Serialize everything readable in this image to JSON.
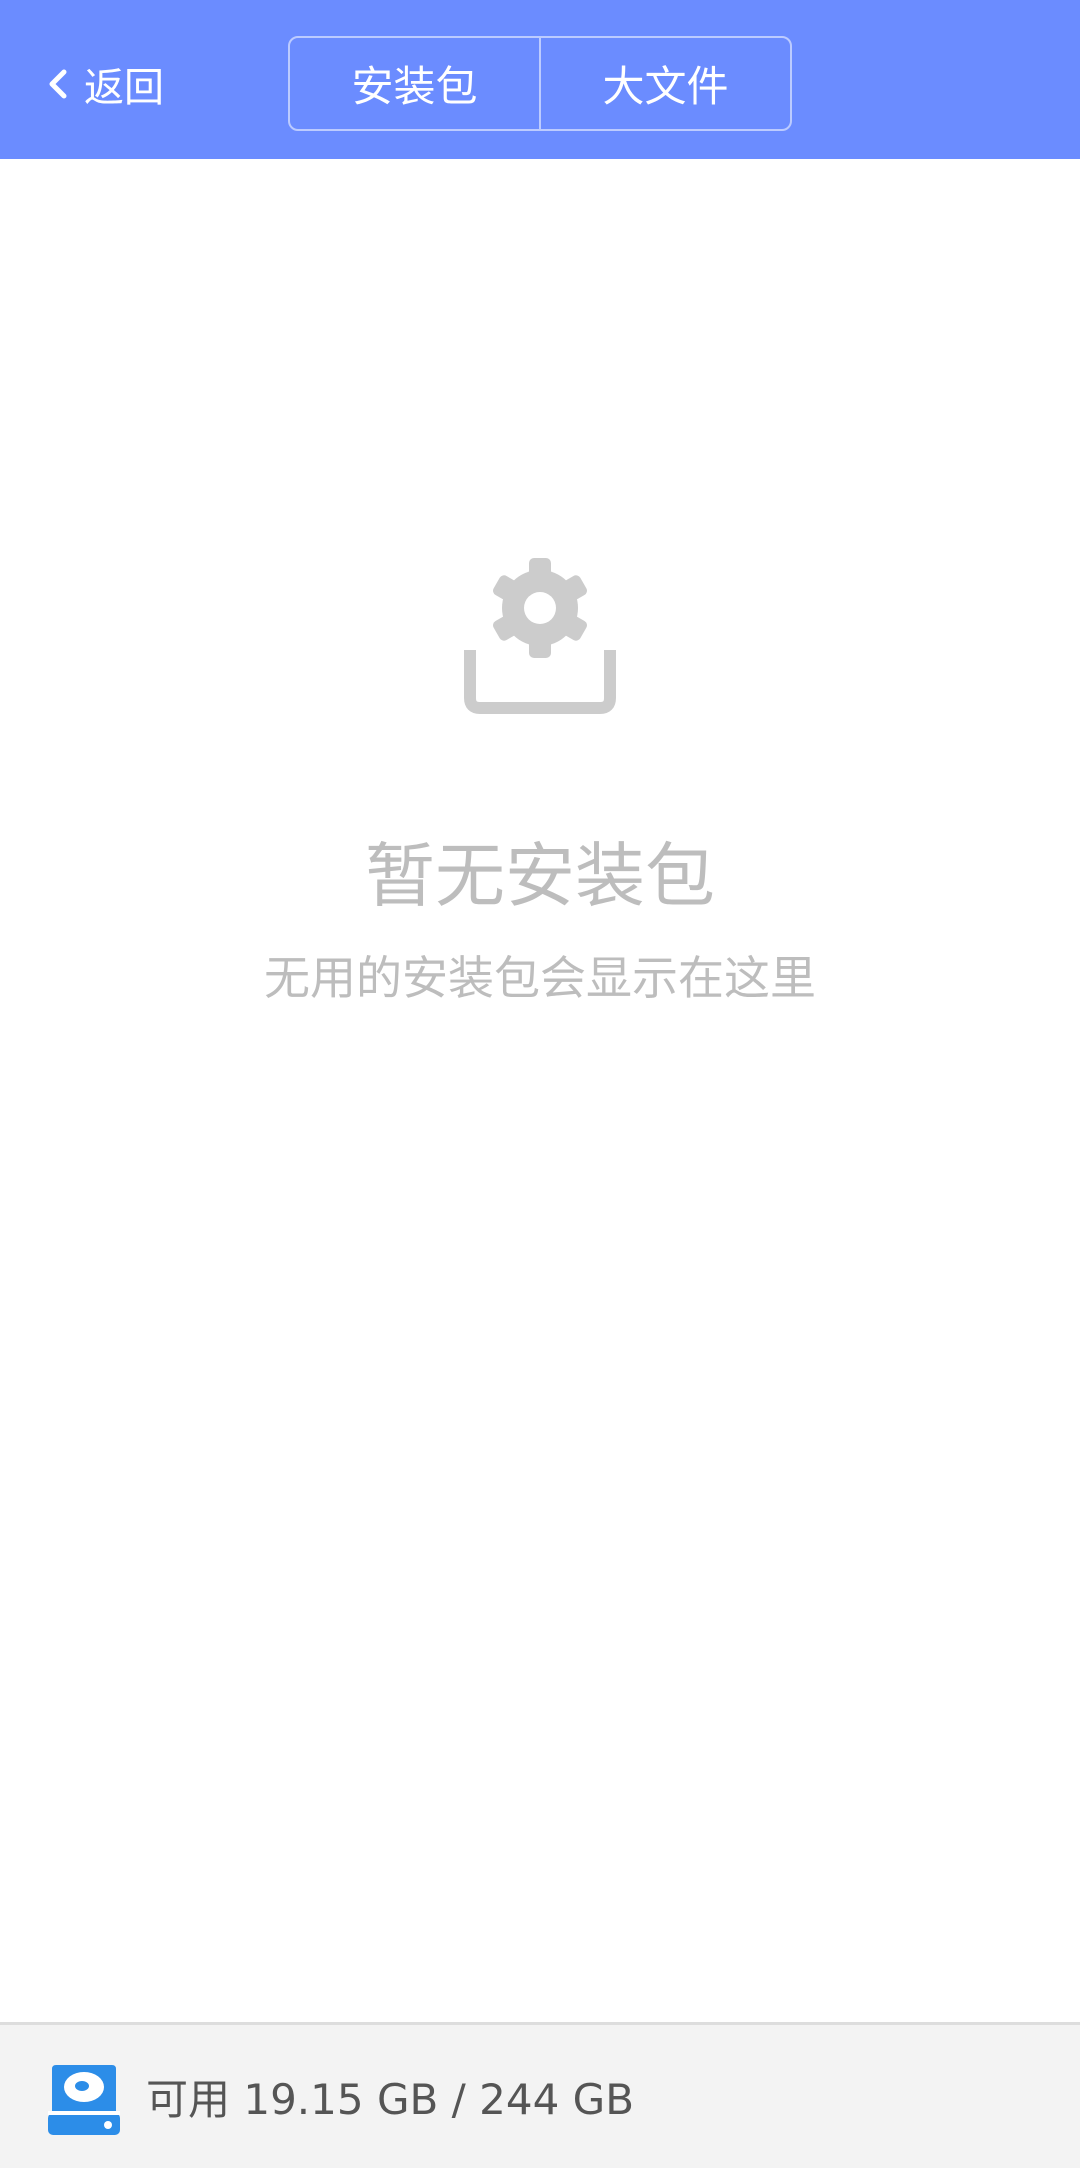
{
  "header": {
    "back_label": "返回",
    "tabs": [
      {
        "label": "安装包",
        "selected": true
      },
      {
        "label": "大文件",
        "selected": false
      }
    ],
    "background_color": "#6b8cff"
  },
  "empty_state": {
    "icon": "package-settings-icon",
    "title": "暂无安装包",
    "subtitle": "无用的安装包会显示在这里"
  },
  "footer": {
    "icon": "drive-icon",
    "storage_label": "可用 19.15 GB / 244 GB"
  }
}
